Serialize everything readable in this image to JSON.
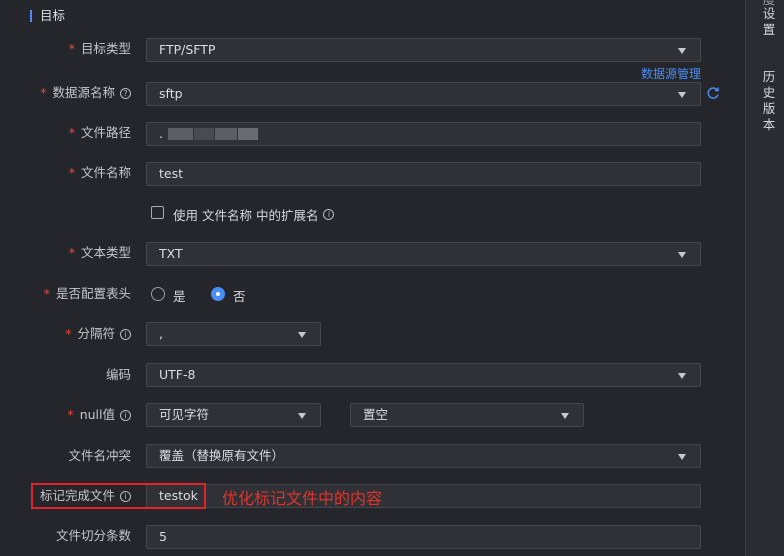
{
  "section": {
    "title": "目标"
  },
  "right_panel": {
    "item1": "设置",
    "item1_partial": "度",
    "item2": "历史版本"
  },
  "form": {
    "target_type": {
      "label": "目标类型",
      "value": "FTP/SFTP",
      "required": "*"
    },
    "datasource_manage_link": "数据源管理",
    "datasource_name": {
      "label": "数据源名称",
      "value": "sftp",
      "required": "*"
    },
    "file_path": {
      "label": "文件路径",
      "value": ".",
      "required": "*"
    },
    "file_name": {
      "label": "文件名称",
      "value": "test",
      "required": "*"
    },
    "use_ext": {
      "label": "使用 文件名称 中的扩展名",
      "checked": false
    },
    "text_type": {
      "label": "文本类型",
      "value": "TXT",
      "required": "*"
    },
    "header": {
      "label": "是否配置表头",
      "required": "*",
      "option_yes": "是",
      "option_no": "否",
      "selected": "否"
    },
    "delimiter": {
      "label": "分隔符",
      "value": ",",
      "required": "*"
    },
    "encoding": {
      "label": "编码",
      "value": "UTF-8"
    },
    "null_value": {
      "label": "null值",
      "required": "*",
      "type_value": "可见字符",
      "value": "置空"
    },
    "conflict": {
      "label": "文件名冲突",
      "value": "覆盖（替换原有文件）"
    },
    "mark_file": {
      "label": "标记完成文件",
      "value": "testok"
    },
    "split_count": {
      "label": "文件切分条数",
      "value": "5"
    }
  },
  "annotation": {
    "text": "优化标记文件中的内容",
    "color": "#e2232a"
  },
  "colors": {
    "accent": "#4b8df8",
    "required": "#f0463c",
    "background": "#25262b"
  }
}
